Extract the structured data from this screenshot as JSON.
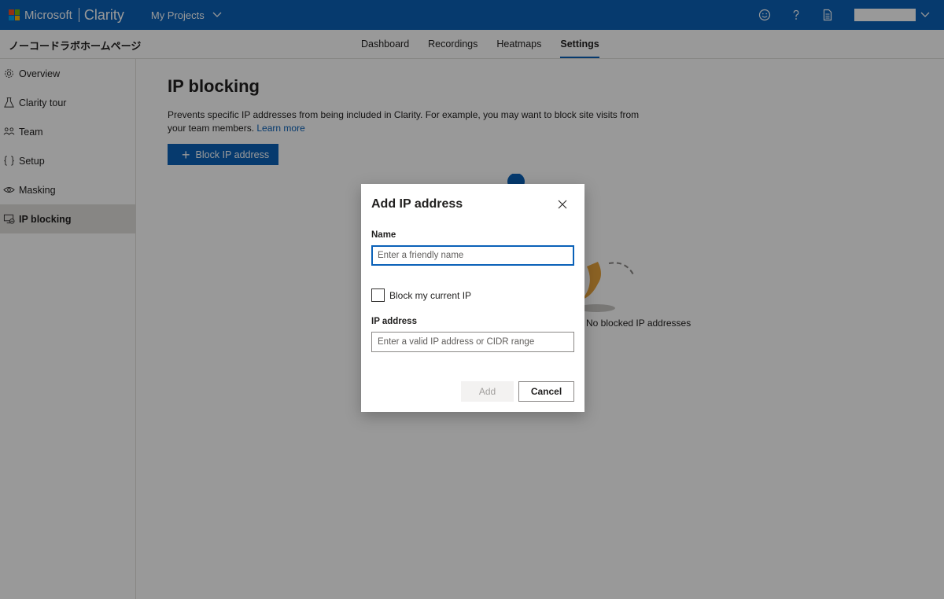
{
  "app": {
    "brand_microsoft": "Microsoft",
    "brand_product": "Clarity",
    "projects_label": "My Projects",
    "logo_colors": [
      "#f25022",
      "#7fba00",
      "#00a4ef",
      "#ffb900"
    ],
    "accent_color": "#0a61b8",
    "top_icons": [
      "smiley-icon",
      "help-icon",
      "document-icon"
    ]
  },
  "project": {
    "name": "ノーコードラボホームページ"
  },
  "tabs": [
    {
      "label": "Dashboard",
      "active": false
    },
    {
      "label": "Recordings",
      "active": false
    },
    {
      "label": "Heatmaps",
      "active": false
    },
    {
      "label": "Settings",
      "active": true
    }
  ],
  "sidebar": {
    "items": [
      {
        "label": "Overview",
        "icon": "gear-icon",
        "active": false
      },
      {
        "label": "Clarity tour",
        "icon": "flask-icon",
        "active": false
      },
      {
        "label": "Team",
        "icon": "people-icon",
        "active": false
      },
      {
        "label": "Setup",
        "icon": "braces-icon",
        "active": false
      },
      {
        "label": "Masking",
        "icon": "eye-mask-icon",
        "active": false
      },
      {
        "label": "IP blocking",
        "icon": "monitor-block-icon",
        "active": true
      }
    ]
  },
  "main": {
    "title": "IP blocking",
    "description": "Prevents specific IP addresses from being included in Clarity. For example, you may want to block site visits from your team members. ",
    "learn_more": "Learn more",
    "block_button": "Block IP address",
    "empty_state_text": "No blocked IP addresses"
  },
  "dialog": {
    "title": "Add IP address",
    "name_label": "Name",
    "name_placeholder": "Enter a friendly name",
    "name_value": "",
    "checkbox_label": "Block my current IP",
    "checkbox_checked": false,
    "ip_label": "IP address",
    "ip_placeholder": "Enter a valid IP address or CIDR range",
    "ip_value": "",
    "add_button": "Add",
    "add_enabled": false,
    "cancel_button": "Cancel"
  }
}
